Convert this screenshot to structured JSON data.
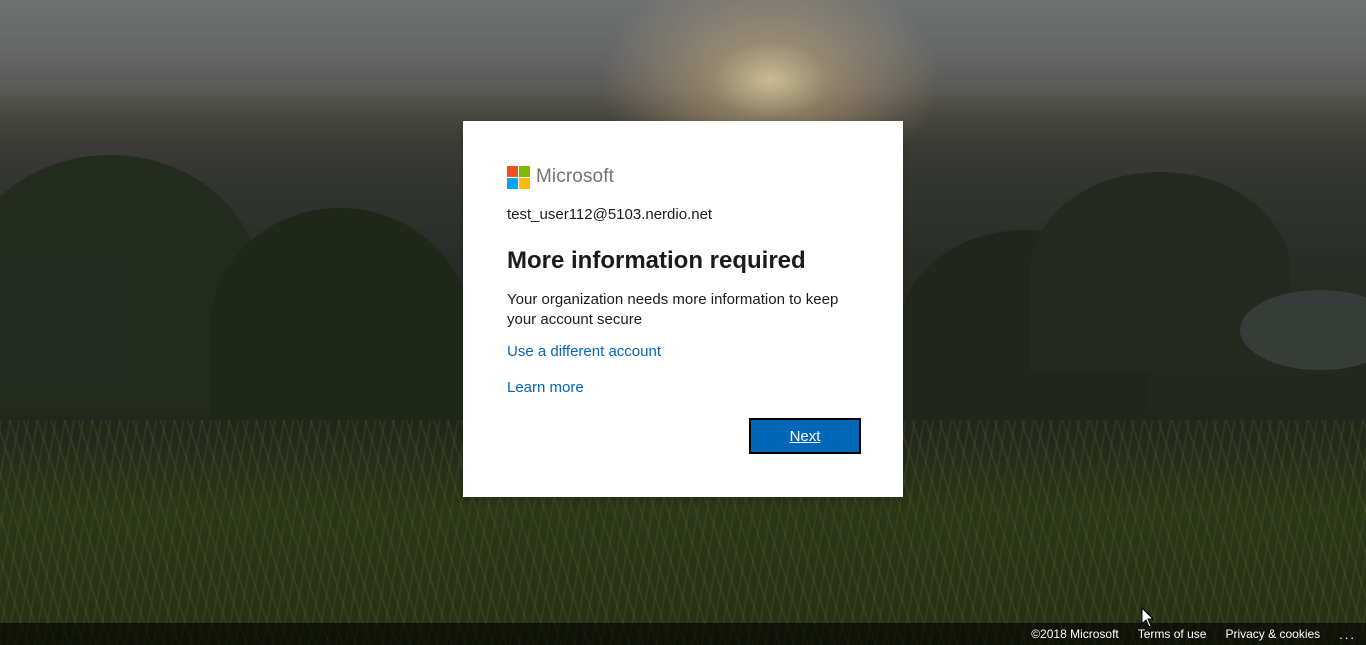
{
  "brand": {
    "name": "Microsoft",
    "logo_colors": [
      "#f25022",
      "#7fba00",
      "#00a4ef",
      "#ffb900"
    ]
  },
  "dialog": {
    "identity": "test_user112@5103.nerdio.net",
    "title": "More information required",
    "description": "Your organization needs more information to keep your account secure",
    "different_account_link": "Use a different account",
    "learn_more_link": "Learn more",
    "next_button": "Next"
  },
  "footer": {
    "copyright": "©2018 Microsoft",
    "terms": "Terms of use",
    "privacy": "Privacy & cookies",
    "more": "..."
  },
  "colors": {
    "accent": "#0067b8",
    "card_bg": "#ffffff",
    "text": "#1b1b1b"
  }
}
